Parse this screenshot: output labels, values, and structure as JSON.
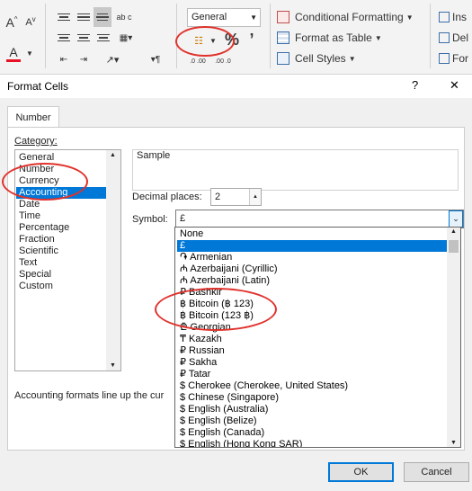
{
  "ribbon": {
    "font_grow": "A",
    "font_shrink": "A",
    "font_color": "A",
    "wrap_text": "ab c",
    "number_format": "General",
    "percent": "%",
    "comma": "’",
    "decimal_inc": ".0 .00",
    "decimal_dec": ".00 .0",
    "conditional_formatting": "Conditional Formatting",
    "format_as_table": "Format as Table",
    "cell_styles": "Cell Styles",
    "insert": "Ins",
    "delete": "Del",
    "format": "For",
    "indent_arrow": "¶"
  },
  "dialog": {
    "title": "Format Cells",
    "help": "?",
    "close": "✕",
    "tab": "Number",
    "category_label": "Category:",
    "categories": [
      "General",
      "Number",
      "Currency",
      "Accounting",
      "Date",
      "Time",
      "Percentage",
      "Fraction",
      "Scientific",
      "Text",
      "Special",
      "Custom"
    ],
    "selected_category": "Accounting",
    "sample_label": "Sample",
    "decimal_label": "Decimal places:",
    "decimal_value": "2",
    "symbol_label": "Symbol:",
    "symbol_value": "£",
    "description": "Accounting formats line up the cur",
    "ok": "OK",
    "cancel": "Cancel",
    "symbol_options": [
      "None",
      "£",
      "֏ Armenian",
      "₼ Azerbaijani (Cyrillic)",
      "₼ Azerbaijani (Latin)",
      "₽ Bashkir",
      "฿ Bitcoin (฿ 123)",
      "฿ Bitcoin (123 ฿)",
      "₾ Georgian",
      "₸ Kazakh",
      "₽ Russian",
      "₽ Sakha",
      "₽ Tatar",
      "$ Cherokee (Cherokee, United States)",
      "$ Chinese (Singapore)",
      "$ English (Australia)",
      "$ English (Belize)",
      "$ English (Canada)",
      "$ English (Hong Kong SAR)"
    ]
  },
  "colors": {
    "accent": "#0078d7",
    "annotation": "#e0322c",
    "font_color_bar": "#e81123"
  }
}
